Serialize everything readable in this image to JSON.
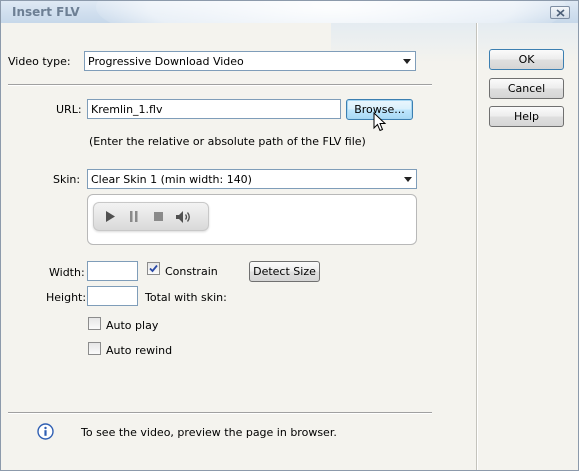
{
  "window": {
    "title": "Insert FLV"
  },
  "form": {
    "video_type_label": "Video type:",
    "video_type_value": "Progressive Download Video",
    "url_label": "URL:",
    "url_value": "Kremlin_1.flv",
    "browse_label": "Browse...",
    "url_hint": "(Enter the relative or absolute path of the FLV file)",
    "skin_label": "Skin:",
    "skin_value": "Clear Skin 1 (min width: 140)",
    "width_label": "Width:",
    "width_value": "",
    "constrain_label": "Constrain",
    "constrain_checked": true,
    "detect_size_label": "Detect Size",
    "height_label": "Height:",
    "height_value": "",
    "total_with_skin_label": "Total with skin:",
    "auto_play_label": "Auto play",
    "auto_play_checked": false,
    "auto_rewind_label": "Auto rewind",
    "auto_rewind_checked": false
  },
  "skin_preview": {
    "controls": [
      "play-icon",
      "pause-icon",
      "stop-icon",
      "volume-icon"
    ]
  },
  "buttons": {
    "ok": "OK",
    "cancel": "Cancel",
    "help": "Help"
  },
  "info": {
    "icon": "info-icon",
    "text": "To see the video, preview the page in browser."
  },
  "colors": {
    "title_text": "#6d7f94",
    "titlebar": "#cfdeee",
    "dialog_bg": "#f4f3ee",
    "field_border": "#7f9db9",
    "info_icon": "#2f5fb3"
  }
}
